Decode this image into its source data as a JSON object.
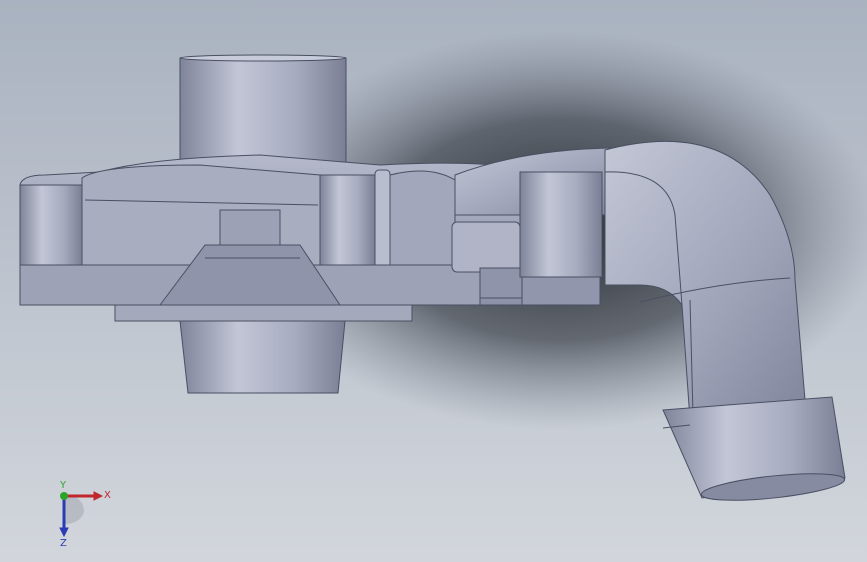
{
  "viewport": {
    "background_top": "#a9b2c0",
    "background_bottom": "#d2d6dc",
    "model_color": "#9aa0b6"
  },
  "triad": {
    "x_label": "X",
    "y_label": "Y",
    "z_label": "Z",
    "x_color": "#c0262c",
    "y_color": "#2aa52a",
    "z_color": "#2b3bb3"
  }
}
